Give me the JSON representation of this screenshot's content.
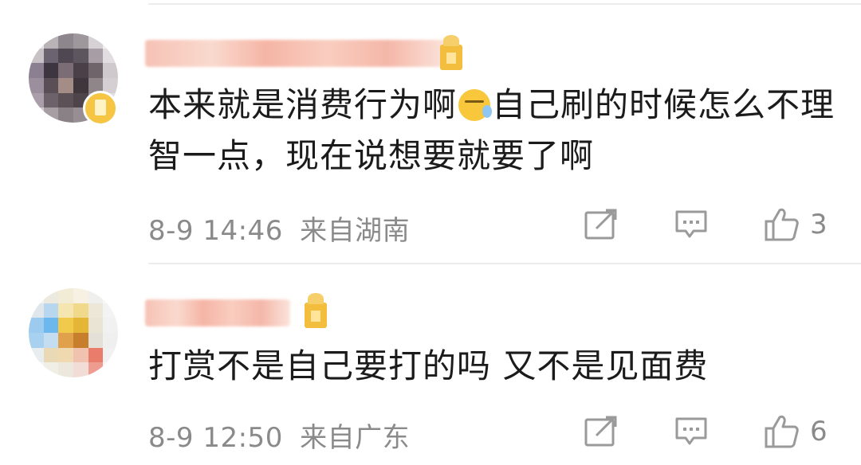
{
  "comments": [
    {
      "text_parts": [
        "本来就是消费行为啊",
        "自己刷的时候怎么不理智一点，现在说想要就要了啊"
      ],
      "emoji": "sweat-emoji",
      "time": "8-9 14:46",
      "location": "来自湖南",
      "likes": "3",
      "has_vip_badge": true
    },
    {
      "text": "打赏不是自己要打的吗 又不是见面费",
      "time": "8-9 12:50",
      "location": "来自广东",
      "likes": "6",
      "has_vip_badge": false
    }
  ],
  "icons": {
    "repost": "repost-icon",
    "comment": "comment-icon",
    "like": "thumbs-up-icon"
  },
  "colors": {
    "text": "#1b1b1b",
    "meta": "#8a8a8a",
    "divider": "#ececec"
  }
}
